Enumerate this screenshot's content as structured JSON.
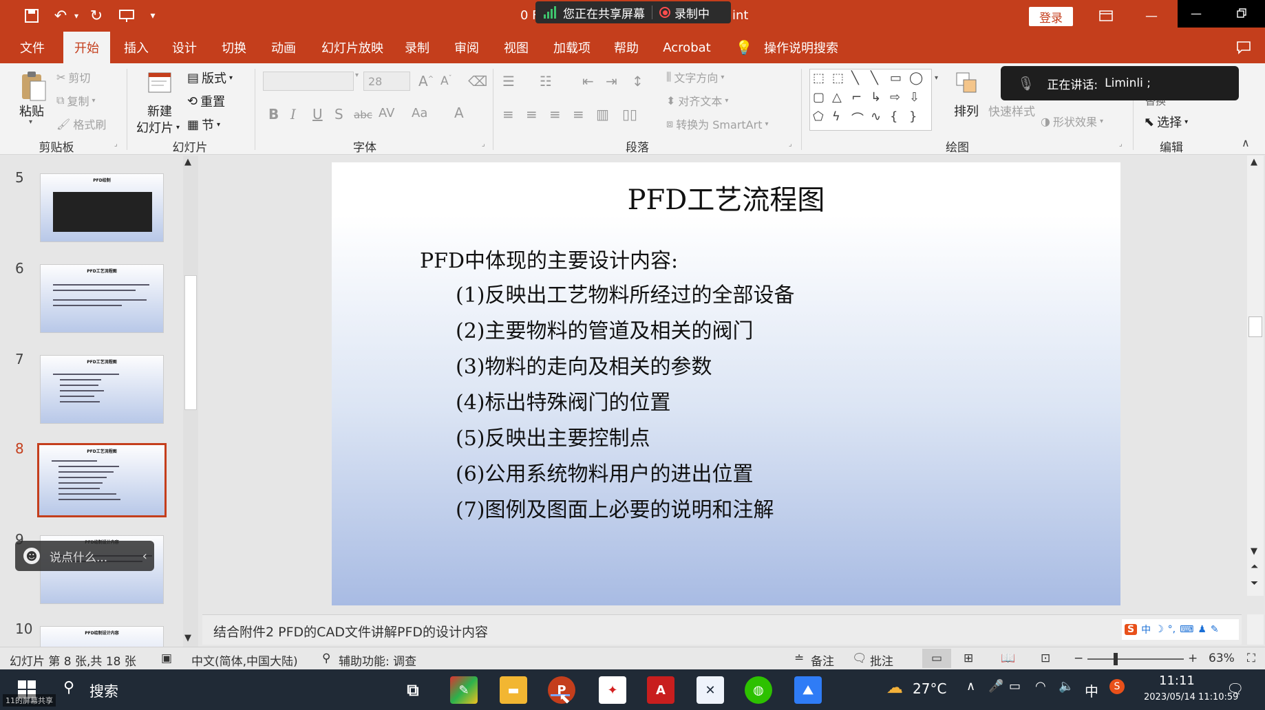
{
  "window": {
    "title_left": "0 F",
    "title_right": "int",
    "share_status": "您正在共享屏幕",
    "recording_status": "录制中",
    "login_label": "登录"
  },
  "tabs": [
    "文件",
    "开始",
    "插入",
    "设计",
    "切换",
    "动画",
    "幻灯片放映",
    "录制",
    "审阅",
    "视图",
    "加载项",
    "帮助",
    "Acrobat",
    "操作说明搜索"
  ],
  "ribbon": {
    "clipboard": {
      "label": "剪贴板",
      "paste": "粘贴",
      "cut": "剪切",
      "copy": "复制",
      "format_painter": "格式刷"
    },
    "slides": {
      "label": "幻灯片",
      "new_slide_1": "新建",
      "new_slide_2": "幻灯片",
      "layout": "版式",
      "reset": "重置",
      "section": "节"
    },
    "font": {
      "label": "字体",
      "size": "28"
    },
    "paragraph": {
      "label": "段落",
      "text_direction": "文字方向",
      "align_text": "对齐文本",
      "smartart": "转换为 SmartArt"
    },
    "drawing": {
      "label": "绘图",
      "arrange": "排列",
      "quick_styles": "快速样式",
      "shape_effects": "形状效果"
    },
    "editing": {
      "label": "编辑",
      "replace": "替换",
      "select": "选择"
    }
  },
  "speaker": {
    "label": "正在讲话:",
    "name": "Liminli ;"
  },
  "thumbnails": [
    {
      "num": "5",
      "title": "PFD绘制"
    },
    {
      "num": "6",
      "title": "PFD工艺流程图"
    },
    {
      "num": "7",
      "title": "PFD工艺流程图"
    },
    {
      "num": "8",
      "title": "PFD工艺流程图"
    },
    {
      "num": "9",
      "title": "PFD绘制设计内容"
    },
    {
      "num": "10",
      "title": "PFD绘制设计内容"
    }
  ],
  "chat_placeholder": "说点什么...",
  "slide": {
    "title": "PFD工艺流程图",
    "intro": "PFD中体现的主要设计内容:",
    "items": [
      "(1)反映出工艺物料所经过的全部设备",
      "(2)主要物料的管道及相关的阀门",
      "(3)物料的走向及相关的参数",
      "(4)标出特殊阀门的位置",
      "(5)反映出主要控制点",
      "(6)公用系统物料用户的进出位置",
      "(7)图例及图面上必要的说明和注解"
    ]
  },
  "notes": "结合附件2 PFD的CAD文件讲解PFD的设计内容",
  "status": {
    "slide_count": "幻灯片 第 8 张,共 18 张",
    "language": "中文(简体,中国大陆)",
    "accessibility": "辅助功能: 调查",
    "notes_btn": "备注",
    "comments_btn": "批注",
    "zoom": "63%"
  },
  "taskbar": {
    "search": "搜索",
    "share_label": "11的屏幕共享",
    "weather": "27°C",
    "ime": "中",
    "time": "11:11",
    "date": "2023/05/14 11:10:59"
  }
}
